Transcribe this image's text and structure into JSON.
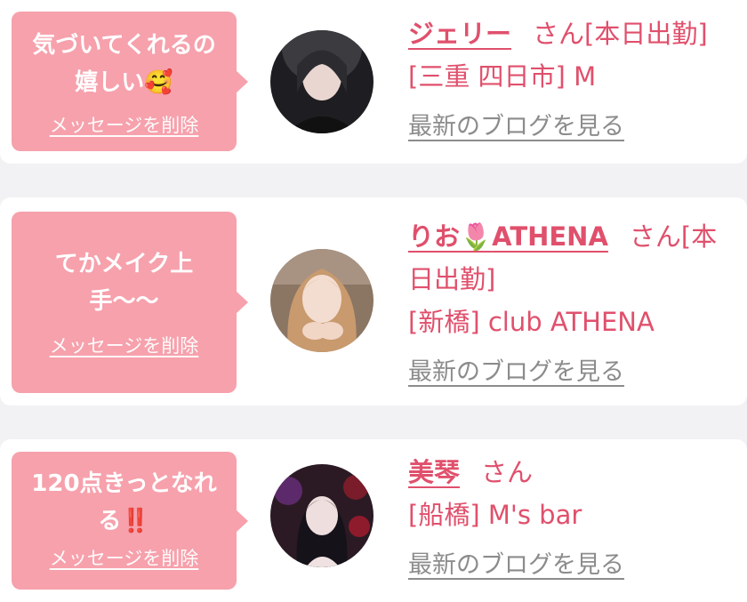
{
  "items": [
    {
      "message_line1": "気づいてくれるの",
      "message_line2": "嬉しい",
      "message_emoji": "🥰",
      "delete_label": "メッセージを削除",
      "name": "ジェリー",
      "suffix": "さん[本日出勤]",
      "store": "[三重 四日市] M",
      "blog_label": "最新のブログを見る",
      "avatar_bg": "#2a2a2a"
    },
    {
      "message_line1": "てかメイク上",
      "message_line2": "手〜〜",
      "delete_label": "メッセージを削除",
      "name_part1": "りお",
      "name_emoji": "🌷",
      "name_part2": "ATHENA",
      "suffix_line1": "さん[本",
      "suffix_line2": "日出勤]",
      "store": "[新橋] club ATHENA",
      "blog_label": "最新のブログを見る",
      "avatar_bg": "#c9a07a"
    },
    {
      "message_line1": "120点きっとなれ",
      "message_line2": "る",
      "message_emoji": "‼️",
      "delete_label": "メッセージを削除",
      "name": "美琴",
      "suffix": "さん",
      "store": "[船橋] M's bar",
      "blog_label": "最新のブログを見る",
      "avatar_bg": "#3a1f2e"
    }
  ]
}
